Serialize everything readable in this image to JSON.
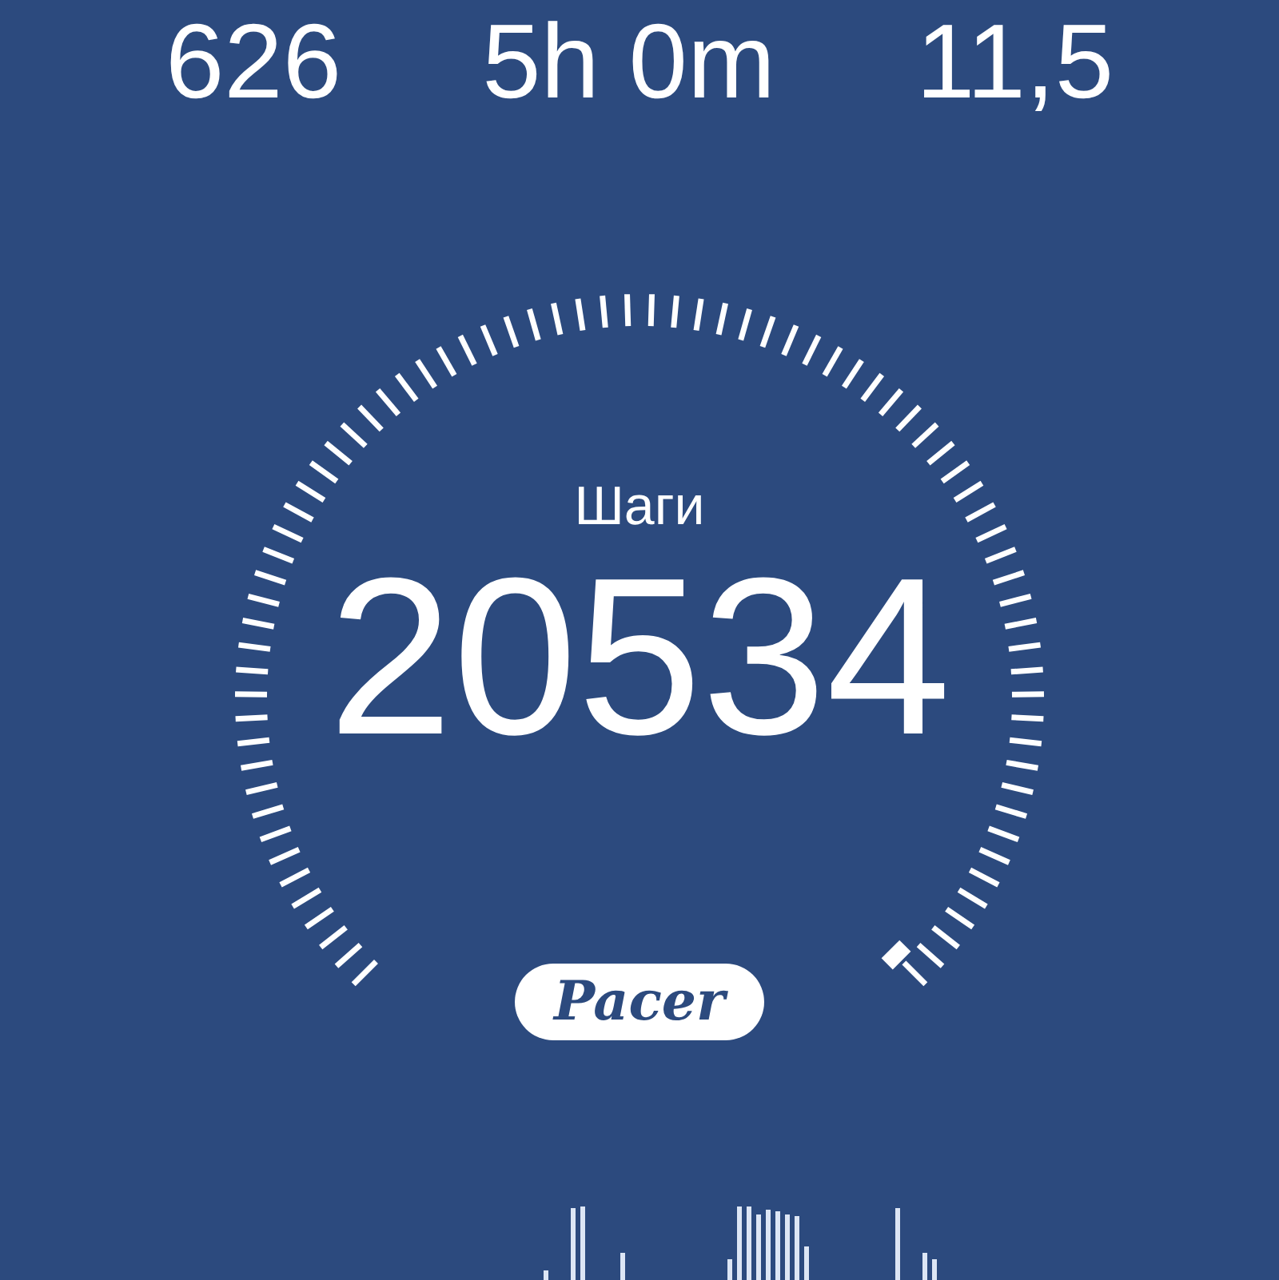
{
  "stats": [
    "626",
    "5h 0m",
    "11,5"
  ],
  "gauge": {
    "label": "Шаги",
    "value": "20534"
  },
  "badge": "Pacer"
}
